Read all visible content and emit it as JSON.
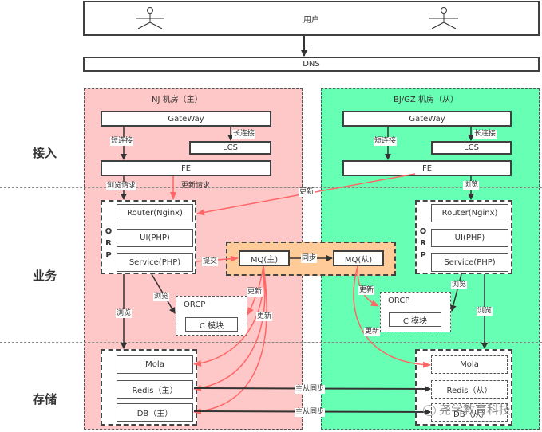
{
  "top": {
    "users_label": "用户",
    "dns_label": "DNS"
  },
  "layers": {
    "access": "接入",
    "business": "业务",
    "storage": "存储"
  },
  "colors": {
    "primary_region": "#ffc8c8",
    "secondary_region": "#66ffb3",
    "mq_region": "#ffcc99",
    "update_arrow": "#ff6666",
    "line": "#333333"
  },
  "nj": {
    "title": "NJ 机房（主）",
    "gateway": "GateWay",
    "lcs": "LCS",
    "fe": "FE",
    "short_conn": "短连接",
    "long_conn": "长连接",
    "browse_request": "浏览请求",
    "update_request": "更新请求",
    "orp_letters": [
      "O",
      "R",
      "P"
    ],
    "router": "Router(Nginx)",
    "ui": "UI(PHP)",
    "service": "Service(PHP)",
    "submit": "提交",
    "orcp_title": "ORCP",
    "c_module": "C 模块",
    "browse1": "浏览",
    "browse2": "浏览",
    "update1": "更新",
    "update2": "更新",
    "mola": "Mola",
    "redis": "Redis（主）",
    "db": "DB（主）"
  },
  "mq": {
    "master": "MQ(主)",
    "slave": "MQ(从)",
    "sync": "同步"
  },
  "bj": {
    "title": "BJ/GZ 机房（从）",
    "gateway": "GateWay",
    "lcs": "LCS",
    "fe": "FE",
    "short_conn": "短连接",
    "long_conn": "长连接",
    "browse": "浏览",
    "update_cross": "更新",
    "orp_letters": [
      "O",
      "R",
      "P"
    ],
    "router": "Router(Nginx)",
    "ui": "UI(PHP)",
    "service": "Service(PHP)",
    "orcp_title": "ORCP",
    "c_module": "C 模块",
    "browse1": "浏览",
    "browse2": "浏览",
    "update1": "更新",
    "update2": "更新",
    "mola": "Mola",
    "redis": "Redis（从）",
    "db": "DB（从）"
  },
  "sync": {
    "redis_sync": "主从同步",
    "db_sync": "主从同步"
  },
  "watermark": "尧学教育科技"
}
